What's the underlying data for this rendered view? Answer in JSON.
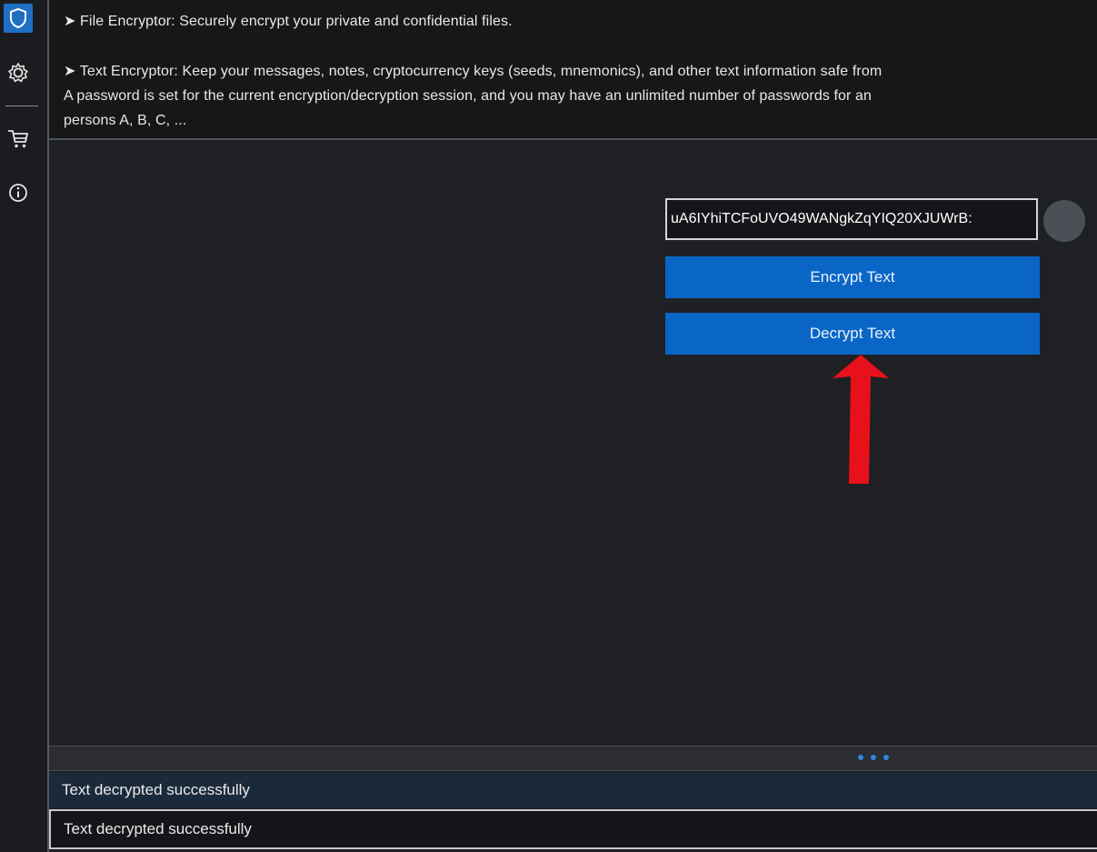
{
  "sidebar": {
    "items": [
      {
        "icon": "shield-icon"
      },
      {
        "icon": "gear-icon"
      },
      {
        "icon": "cart-icon"
      },
      {
        "icon": "info-icon"
      }
    ]
  },
  "info": {
    "line1": "➤ File Encryptor: Securely encrypt your private and confidential files.",
    "line2": "➤ Text Encryptor: Keep your messages, notes, cryptocurrency keys (seeds, mnemonics), and other text information safe from",
    "line3": "A password is set for the current encryption/decryption session, and you may have an unlimited number of passwords for an",
    "line4": "persons A, B, C, ..."
  },
  "password": {
    "value": "uA6IYhiTCFoUVO49WANgkZqYIQ20XJUWrB:"
  },
  "buttons": {
    "encrypt": "Encrypt Text",
    "decrypt": "Decrypt Text"
  },
  "status": {
    "row1": "Text decrypted successfully",
    "row2": "Text decrypted successfully"
  },
  "colors": {
    "accent": "#0966c6",
    "annotation_arrow": "#e8101a"
  }
}
